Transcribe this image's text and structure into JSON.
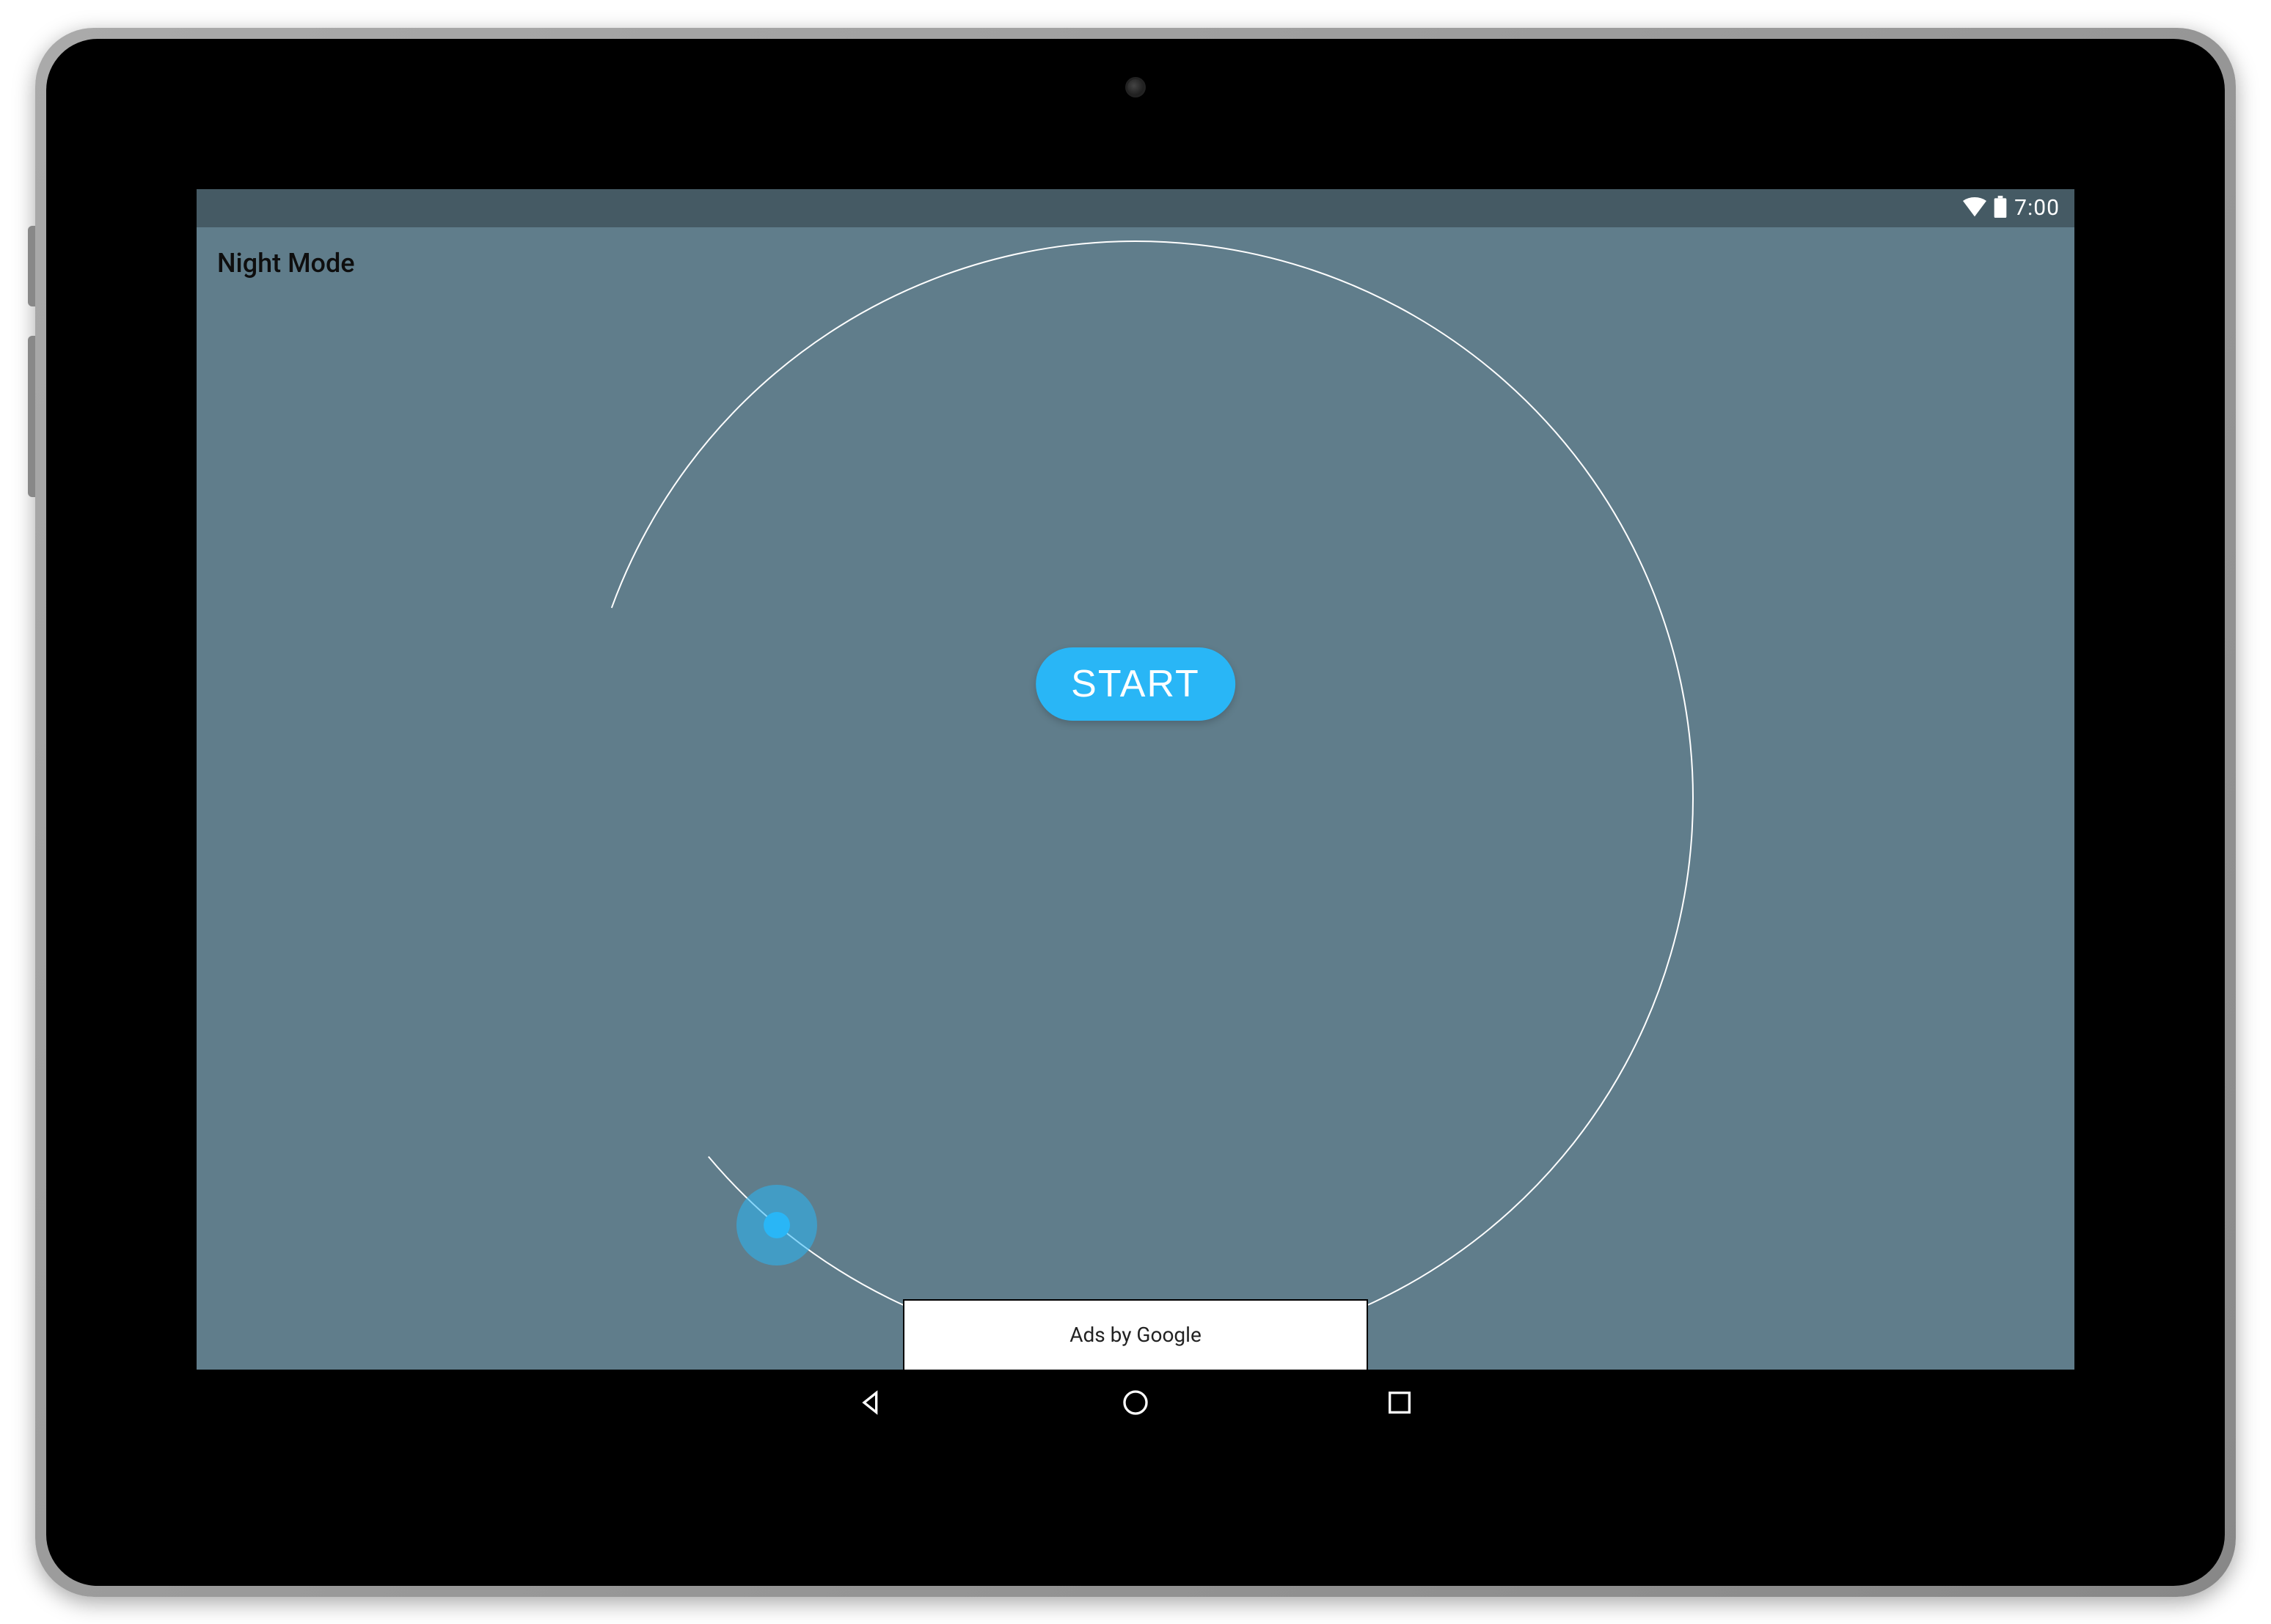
{
  "status_bar": {
    "time": "7:00"
  },
  "app": {
    "title": "Night Mode",
    "start_button_label": "START",
    "dial": {
      "arc_start_deg": 290,
      "arc_end_deg": 230,
      "handle_angle_deg": 220,
      "dial_color": "#ffffff",
      "handle_color": "#29b6f6"
    },
    "accent_color": "#29b6f6",
    "background_color": "#607d8b",
    "status_bar_color": "#455a64"
  },
  "ad": {
    "label": "Ads by Google"
  },
  "nav": {
    "back": "Back",
    "home": "Home",
    "recents": "Recents"
  }
}
